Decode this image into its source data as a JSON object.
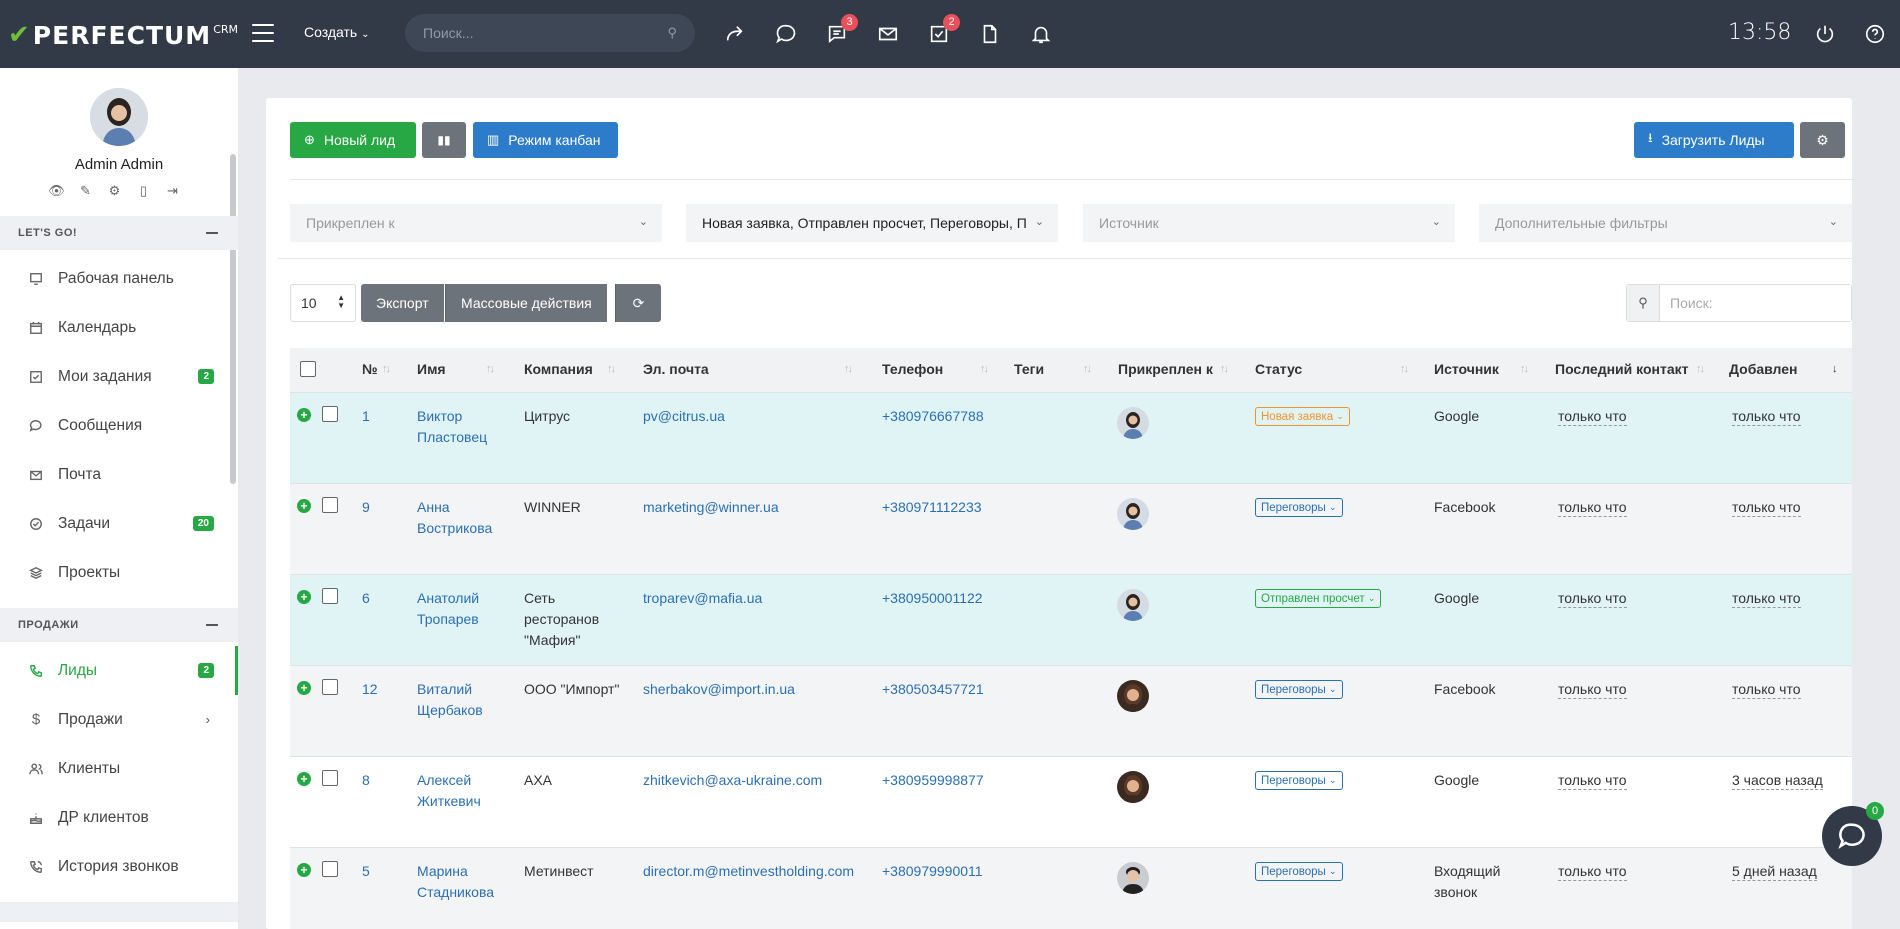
{
  "topbar": {
    "logo": "PERFECTUM",
    "logo_sup": "CRM",
    "create_label": "Создать",
    "search_placeholder": "Поиск...",
    "badges": {
      "messages": "3",
      "tasks": "2"
    },
    "clock": "13:58"
  },
  "sidebar": {
    "user_name": "Admin Admin",
    "sections": [
      {
        "title": "LET'S GO!"
      },
      {
        "title": "ПРОДАЖИ"
      }
    ],
    "items": [
      {
        "label": "Рабочая панель",
        "icon": "monitor-icon"
      },
      {
        "label": "Календарь",
        "icon": "calendar-icon"
      },
      {
        "label": "Мои задания",
        "icon": "checkbox-icon",
        "badge": "2"
      },
      {
        "label": "Сообщения",
        "icon": "chat-icon"
      },
      {
        "label": "Почта",
        "icon": "mail-icon"
      },
      {
        "label": "Задачи",
        "icon": "check-circle-icon",
        "badge": "20"
      },
      {
        "label": "Проекты",
        "icon": "layers-icon"
      },
      {
        "label": "Лиды",
        "icon": "phone-icon",
        "badge": "2",
        "active": true
      },
      {
        "label": "Продажи",
        "icon": "dollar-icon"
      },
      {
        "label": "Клиенты",
        "icon": "users-icon"
      },
      {
        "label": "ДР клиентов",
        "icon": "cake-icon"
      },
      {
        "label": "История звонков",
        "icon": "phone-call-icon"
      }
    ]
  },
  "toolbar": {
    "new_lead": "Новый лид",
    "kanban": "Режим канбан",
    "upload": "Загрузить Лиды"
  },
  "filters": {
    "attached": "Прикреплен к",
    "statuses": "Новая заявка, Отправлен просчет, Переговоры, П",
    "source": "Источник",
    "extra": "Дополнительные фильтры"
  },
  "table_controls": {
    "page_length": "10",
    "export": "Экспорт",
    "bulk": "Массовые действия",
    "search_placeholder": "Поиск:"
  },
  "columns": [
    "№",
    "Имя",
    "Компания",
    "Эл. почта",
    "Телефон",
    "Теги",
    "Прикреплен к",
    "Статус",
    "Источник",
    "Последний контакт",
    "Добавлен"
  ],
  "rows": [
    {
      "id": "1",
      "name1": "Виктор",
      "name2": "Пластовец",
      "company1": "Цитрус",
      "company2": "",
      "company3": "",
      "email": "pv@citrus.ua",
      "phone": "+380976667788",
      "status": "Новая заявка",
      "status_color": "#f0932b",
      "source1": "Google",
      "source2": "",
      "last_contact": "только что",
      "added": "только что",
      "avatar": "female",
      "style": "hl"
    },
    {
      "id": "9",
      "name1": "Анна",
      "name2": "Вострикова",
      "company1": "WINNER",
      "company2": "",
      "company3": "",
      "email": "marketing@winner.ua",
      "phone": "+380971112233",
      "status": "Переговоры",
      "status_color": "#2b6fb3",
      "source1": "Facebook",
      "source2": "",
      "last_contact": "только что",
      "added": "только что",
      "avatar": "female",
      "style": "gr"
    },
    {
      "id": "6",
      "name1": "Анатолий",
      "name2": "Тропарев",
      "company1": "Сеть",
      "company2": "ресторанов",
      "company3": "\"Мафия\"",
      "email": "troparev@mafia.ua",
      "phone": "+380950001122",
      "status": "Отправлен просчет",
      "status_color": "#27a844",
      "source1": "Google",
      "source2": "",
      "last_contact": "только что",
      "added": "только что",
      "avatar": "female",
      "style": "hl"
    },
    {
      "id": "12",
      "name1": "Виталий",
      "name2": "Щербаков",
      "company1": "ООО \"Импорт\"",
      "company2": "",
      "company3": "",
      "email": "sherbakov@import.in.ua",
      "phone": "+380503457721",
      "status": "Переговоры",
      "status_color": "#2b6fb3",
      "source1": "Facebook",
      "source2": "",
      "last_contact": "только что",
      "added": "только что",
      "avatar": "woman-dark",
      "style": "gr"
    },
    {
      "id": "8",
      "name1": "Алексей",
      "name2": "Житкевич",
      "company1": "AXA",
      "company2": "",
      "company3": "",
      "email": "zhitkevich@axa-ukraine.com",
      "phone": "+380959998877",
      "status": "Переговоры",
      "status_color": "#2b6fb3",
      "source1": "Google",
      "source2": "",
      "last_contact": "только что",
      "added": "3 часов назад",
      "avatar": "woman-dark",
      "style": "wh"
    },
    {
      "id": "5",
      "name1": "Марина",
      "name2": "Стадникова",
      "company1": "Метинвест",
      "company2": "",
      "company3": "",
      "email": "director.m@metinvestholding.com",
      "phone": "+380979990011",
      "status": "Переговоры",
      "status_color": "#2b6fb3",
      "source1": "Входящий",
      "source2": "звонок",
      "last_contact": "только что",
      "added": "5 дней назад",
      "avatar": "man",
      "style": "gr"
    }
  ],
  "chat_badge": "0"
}
